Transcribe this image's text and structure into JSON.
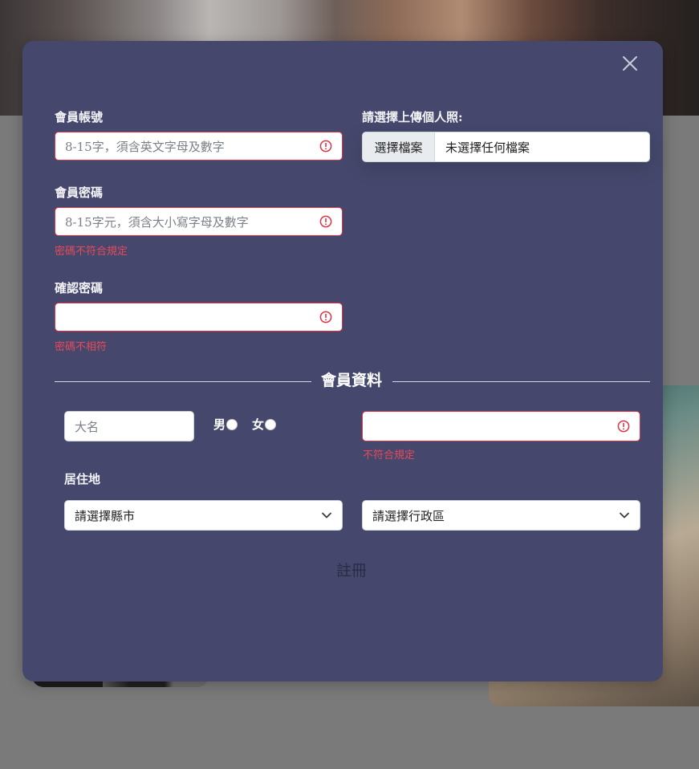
{
  "form": {
    "account": {
      "label": "會員帳號",
      "placeholder": "8-15字，須含英文字母及數字"
    },
    "photo": {
      "label": "請選擇上傳個人照:",
      "button_label": "選擇檔案",
      "file_status": "未選擇任何檔案"
    },
    "password": {
      "label": "會員密碼",
      "placeholder": "8-15字元，須含大小寫字母及數字",
      "error": "密碼不符合規定"
    },
    "confirm_password": {
      "label": "確認密碼",
      "error": "密碼不相符"
    },
    "section_title": "會員資料",
    "name": {
      "placeholder": "大名"
    },
    "gender": {
      "male": "男",
      "female": "女"
    },
    "phone": {
      "error": "不符合規定"
    },
    "residence": {
      "label": "居住地",
      "city_placeholder": "請選擇縣市",
      "district_placeholder": "請選擇行政區"
    },
    "submit_label": "註冊"
  },
  "colors": {
    "modal_bg": "#45486c",
    "error": "#dc3545",
    "error_text": "#e64a5a"
  }
}
